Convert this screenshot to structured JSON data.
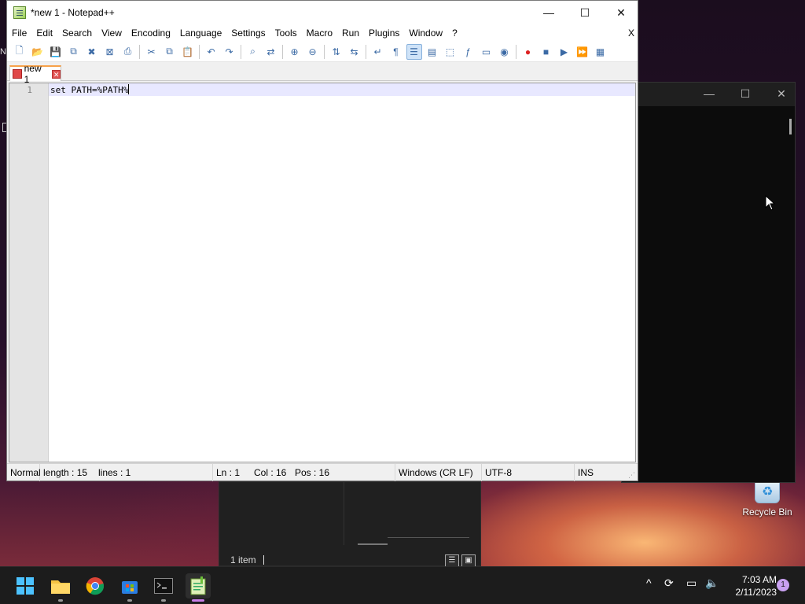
{
  "notepad": {
    "title": "*new 1 - Notepad++",
    "menu": [
      "File",
      "Edit",
      "Search",
      "View",
      "Encoding",
      "Language",
      "Settings",
      "Tools",
      "Macro",
      "Run",
      "Plugins",
      "Window",
      "?"
    ],
    "menu_close": "X",
    "tab": {
      "label": "new 1"
    },
    "editor": {
      "line_number": "1",
      "content": "set PATH=%PATH%"
    },
    "status": {
      "mode": "Normal",
      "length": "length : 15",
      "lines": "lines : 1",
      "ln": "Ln : 1",
      "col": "Col : 16",
      "pos": "Pos : 16",
      "eol": "Windows (CR LF)",
      "encoding": "UTF-8",
      "ins": "INS"
    },
    "toolbar_icons": [
      "new-file-icon",
      "open-file-icon",
      "save-icon",
      "save-all-icon",
      "close-icon",
      "close-all-icon",
      "print-icon",
      "cut-icon",
      "copy-icon",
      "paste-icon",
      "undo-icon",
      "redo-icon",
      "find-icon",
      "replace-icon",
      "zoom-in-icon",
      "zoom-out-icon",
      "sync-vertical-icon",
      "sync-horizontal-icon",
      "word-wrap-icon",
      "show-all-chars-icon",
      "indent-guide-icon",
      "udl-icon",
      "doc-map-icon",
      "function-list-icon",
      "folder-workspace-icon",
      "monitoring-icon",
      "record-macro-icon",
      "stop-macro-icon",
      "play-macro-icon",
      "run-macro-multiple-icon",
      "save-macro-icon"
    ]
  },
  "explorer": {
    "item_count": "1 item"
  },
  "desktop": {
    "recycle_bin": "Recycle Bin"
  },
  "taskbar": {
    "clock_time": "7:03 AM",
    "clock_date": "2/11/2023",
    "notification_count": "1"
  },
  "colors": {
    "tab_accent": "#f7a24a",
    "current_line": "#e8e8ff",
    "taskbar": "#1c1c1c"
  }
}
